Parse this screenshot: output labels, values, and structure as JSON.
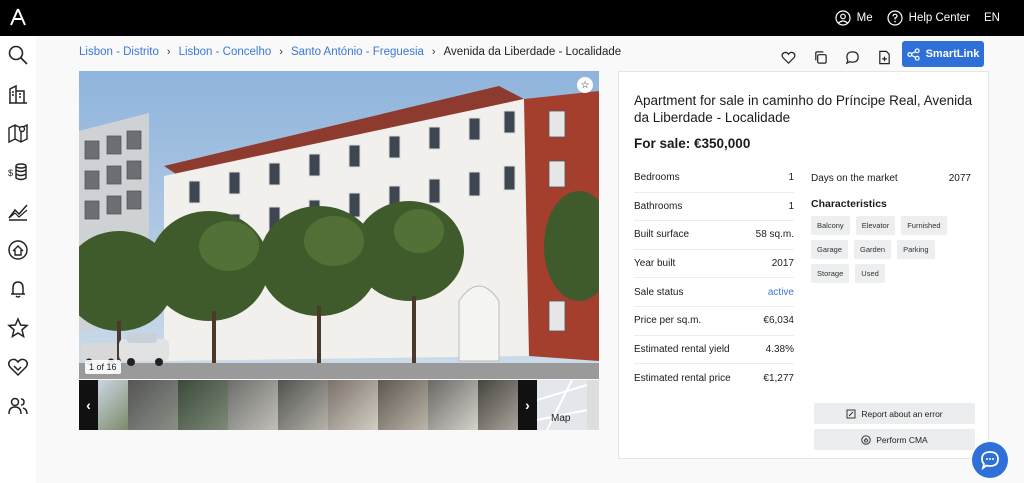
{
  "topbar": {
    "logo_icon": "fictional-logo",
    "me_label": "Me",
    "help_label": "Help Center",
    "language": "EN"
  },
  "sidebar": {
    "icons": [
      "search-icon",
      "buildings-icon",
      "map-pin-icon",
      "coins-icon",
      "chart-icon",
      "home-icon",
      "bell-icon",
      "star-icon",
      "handshake-icon",
      "users-icon"
    ]
  },
  "breadcrumb": {
    "items": [
      "Lisbon - Distrito",
      "Lisbon - Concelho",
      "Santo António - Freguesia"
    ],
    "current": "Avenida da Liberdade - Localidade"
  },
  "toolbar": {
    "smartlink_label": "SmartLink"
  },
  "gallery": {
    "counter": "1 of 16",
    "map_label": "Map"
  },
  "listing": {
    "title": "Apartment for sale in caminho do Príncipe Real, Avenida da Liberdade - Localidade",
    "price": "For sale: €350,000",
    "specs": [
      {
        "label": "Bedrooms",
        "value": "1"
      },
      {
        "label": "Bathrooms",
        "value": "1"
      },
      {
        "label": "Built surface",
        "value": "58 sq.m."
      },
      {
        "label": "Year built",
        "value": "2017"
      },
      {
        "label": "Sale status",
        "value": "active"
      },
      {
        "label": "Price per sq.m.",
        "value": "€6,034"
      },
      {
        "label": "Estimated rental yield",
        "value": "4.38%"
      },
      {
        "label": "Estimated rental price",
        "value": "€1,277"
      }
    ],
    "days_on_market_label": "Days on the market",
    "days_on_market_value": "2077",
    "characteristics_title": "Characteristics",
    "tags": [
      "Balcony",
      "Elevator",
      "Furnished",
      "Garage",
      "Garden",
      "Parking",
      "Storage",
      "Used"
    ],
    "report_label": "Report about an error",
    "cma_label": "Perform CMA"
  },
  "colors": {
    "accent": "#2f70d8",
    "link": "#3a78d6",
    "topbar": "#000000"
  }
}
